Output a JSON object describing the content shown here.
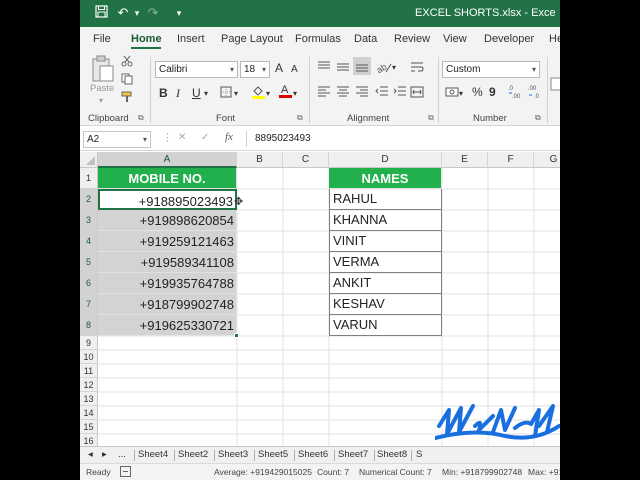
{
  "titlebar": {
    "title": "EXCEL SHORTS.xlsx  -  Exce",
    "save_icon": "💾",
    "undo_icon": "↶",
    "undo_more": "▾",
    "redo_icon": "↷",
    "customize_icon": "▾"
  },
  "menu": {
    "tabs": [
      "File",
      "Home",
      "Insert",
      "Page Layout",
      "Formulas",
      "Data",
      "Review",
      "View",
      "Developer",
      "He"
    ]
  },
  "ribbon": {
    "clipboard": {
      "label": "Clipboard",
      "paste_label": "Paste"
    },
    "font": {
      "label": "Font",
      "font_name": "Calibri",
      "font_size": "18",
      "grow": "A",
      "shrink": "A",
      "bold": "B",
      "italic": "I",
      "underline": "U"
    },
    "alignment": {
      "label": "Alignment"
    },
    "number": {
      "label": "Number",
      "format": "Custom",
      "percent": "%",
      "comma": "9"
    }
  },
  "formula_bar": {
    "name_box": "A2",
    "fx": "fx",
    "cancel": "✕",
    "enter": "✓",
    "value": "8895023493"
  },
  "grid": {
    "columns": [
      "A",
      "B",
      "C",
      "D",
      "E",
      "F",
      "G"
    ],
    "rows": [
      "1",
      "2",
      "3",
      "4",
      "5",
      "6",
      "7",
      "8",
      "9",
      "10",
      "11",
      "12",
      "13",
      "14",
      "15",
      "16"
    ],
    "header_a": "MOBILE NO.",
    "header_d": "NAMES",
    "mobile_numbers": [
      "+918895023493",
      "+919898620854",
      "+919259121463",
      "+919589341108",
      "+919935764788",
      "+918799902748",
      "+919625330721"
    ],
    "names": [
      "RAHUL",
      "KHANNA",
      "VINIT",
      "VERMA",
      "ANKIT",
      "KESHAV",
      "VARUN"
    ],
    "header_color": "#21B04B",
    "selection_color": "#D3D3D3"
  },
  "sheet_tabs": {
    "prev_icon": "◂",
    "next_icon": "▸",
    "ellipsis": "...",
    "tabs": [
      "Sheet4",
      "Sheet2",
      "Sheet3",
      "Sheet5",
      "Sheet6",
      "Sheet7",
      "Sheet8",
      "S"
    ]
  },
  "status": {
    "ready": "Ready",
    "average": "Average: +919429015025",
    "count": "Count: 7",
    "numerical_count": "Numerical Count: 7",
    "min": "Min: +918799902748",
    "max": "Max: +91"
  },
  "brand": {
    "accent": "#217346",
    "watermark_color": "#1A6FE0"
  }
}
